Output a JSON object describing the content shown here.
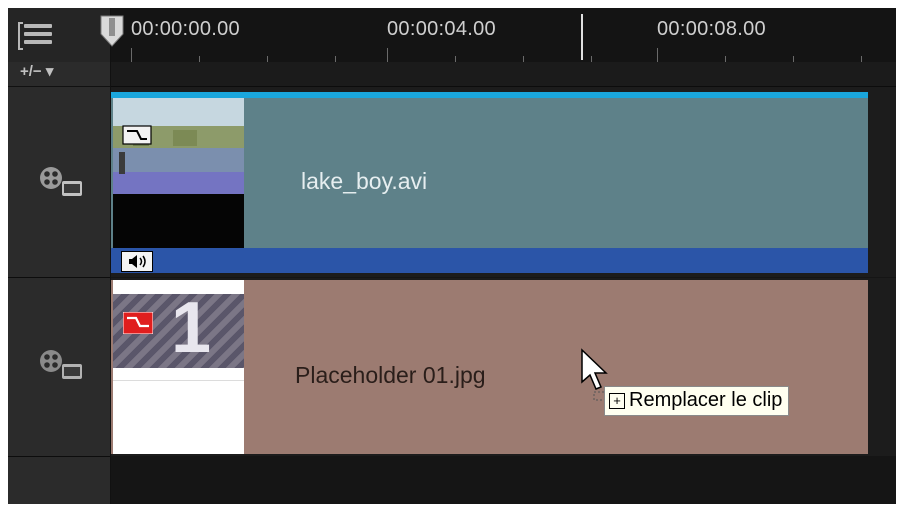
{
  "ruler": {
    "timecodes": [
      "00:00:00.00",
      "00:00:04.00",
      "00:00:08.00"
    ]
  },
  "toolbar": {
    "zoom_label": "+/− ▾"
  },
  "tracks": [
    {
      "clip": {
        "name": "lake_boy.avi",
        "audio_icon": "speaker-icon"
      }
    },
    {
      "clip": {
        "name": "Placeholder 01.jpg",
        "thumb_number": "1"
      }
    }
  ],
  "tooltip": {
    "label": "Remplacer le clip"
  },
  "colors": {
    "video_clip": "#5e8189",
    "audio_strip": "#2b55a8",
    "placeholder_clip": "#9c7b71",
    "selection_bar": "#1aa6dc"
  }
}
